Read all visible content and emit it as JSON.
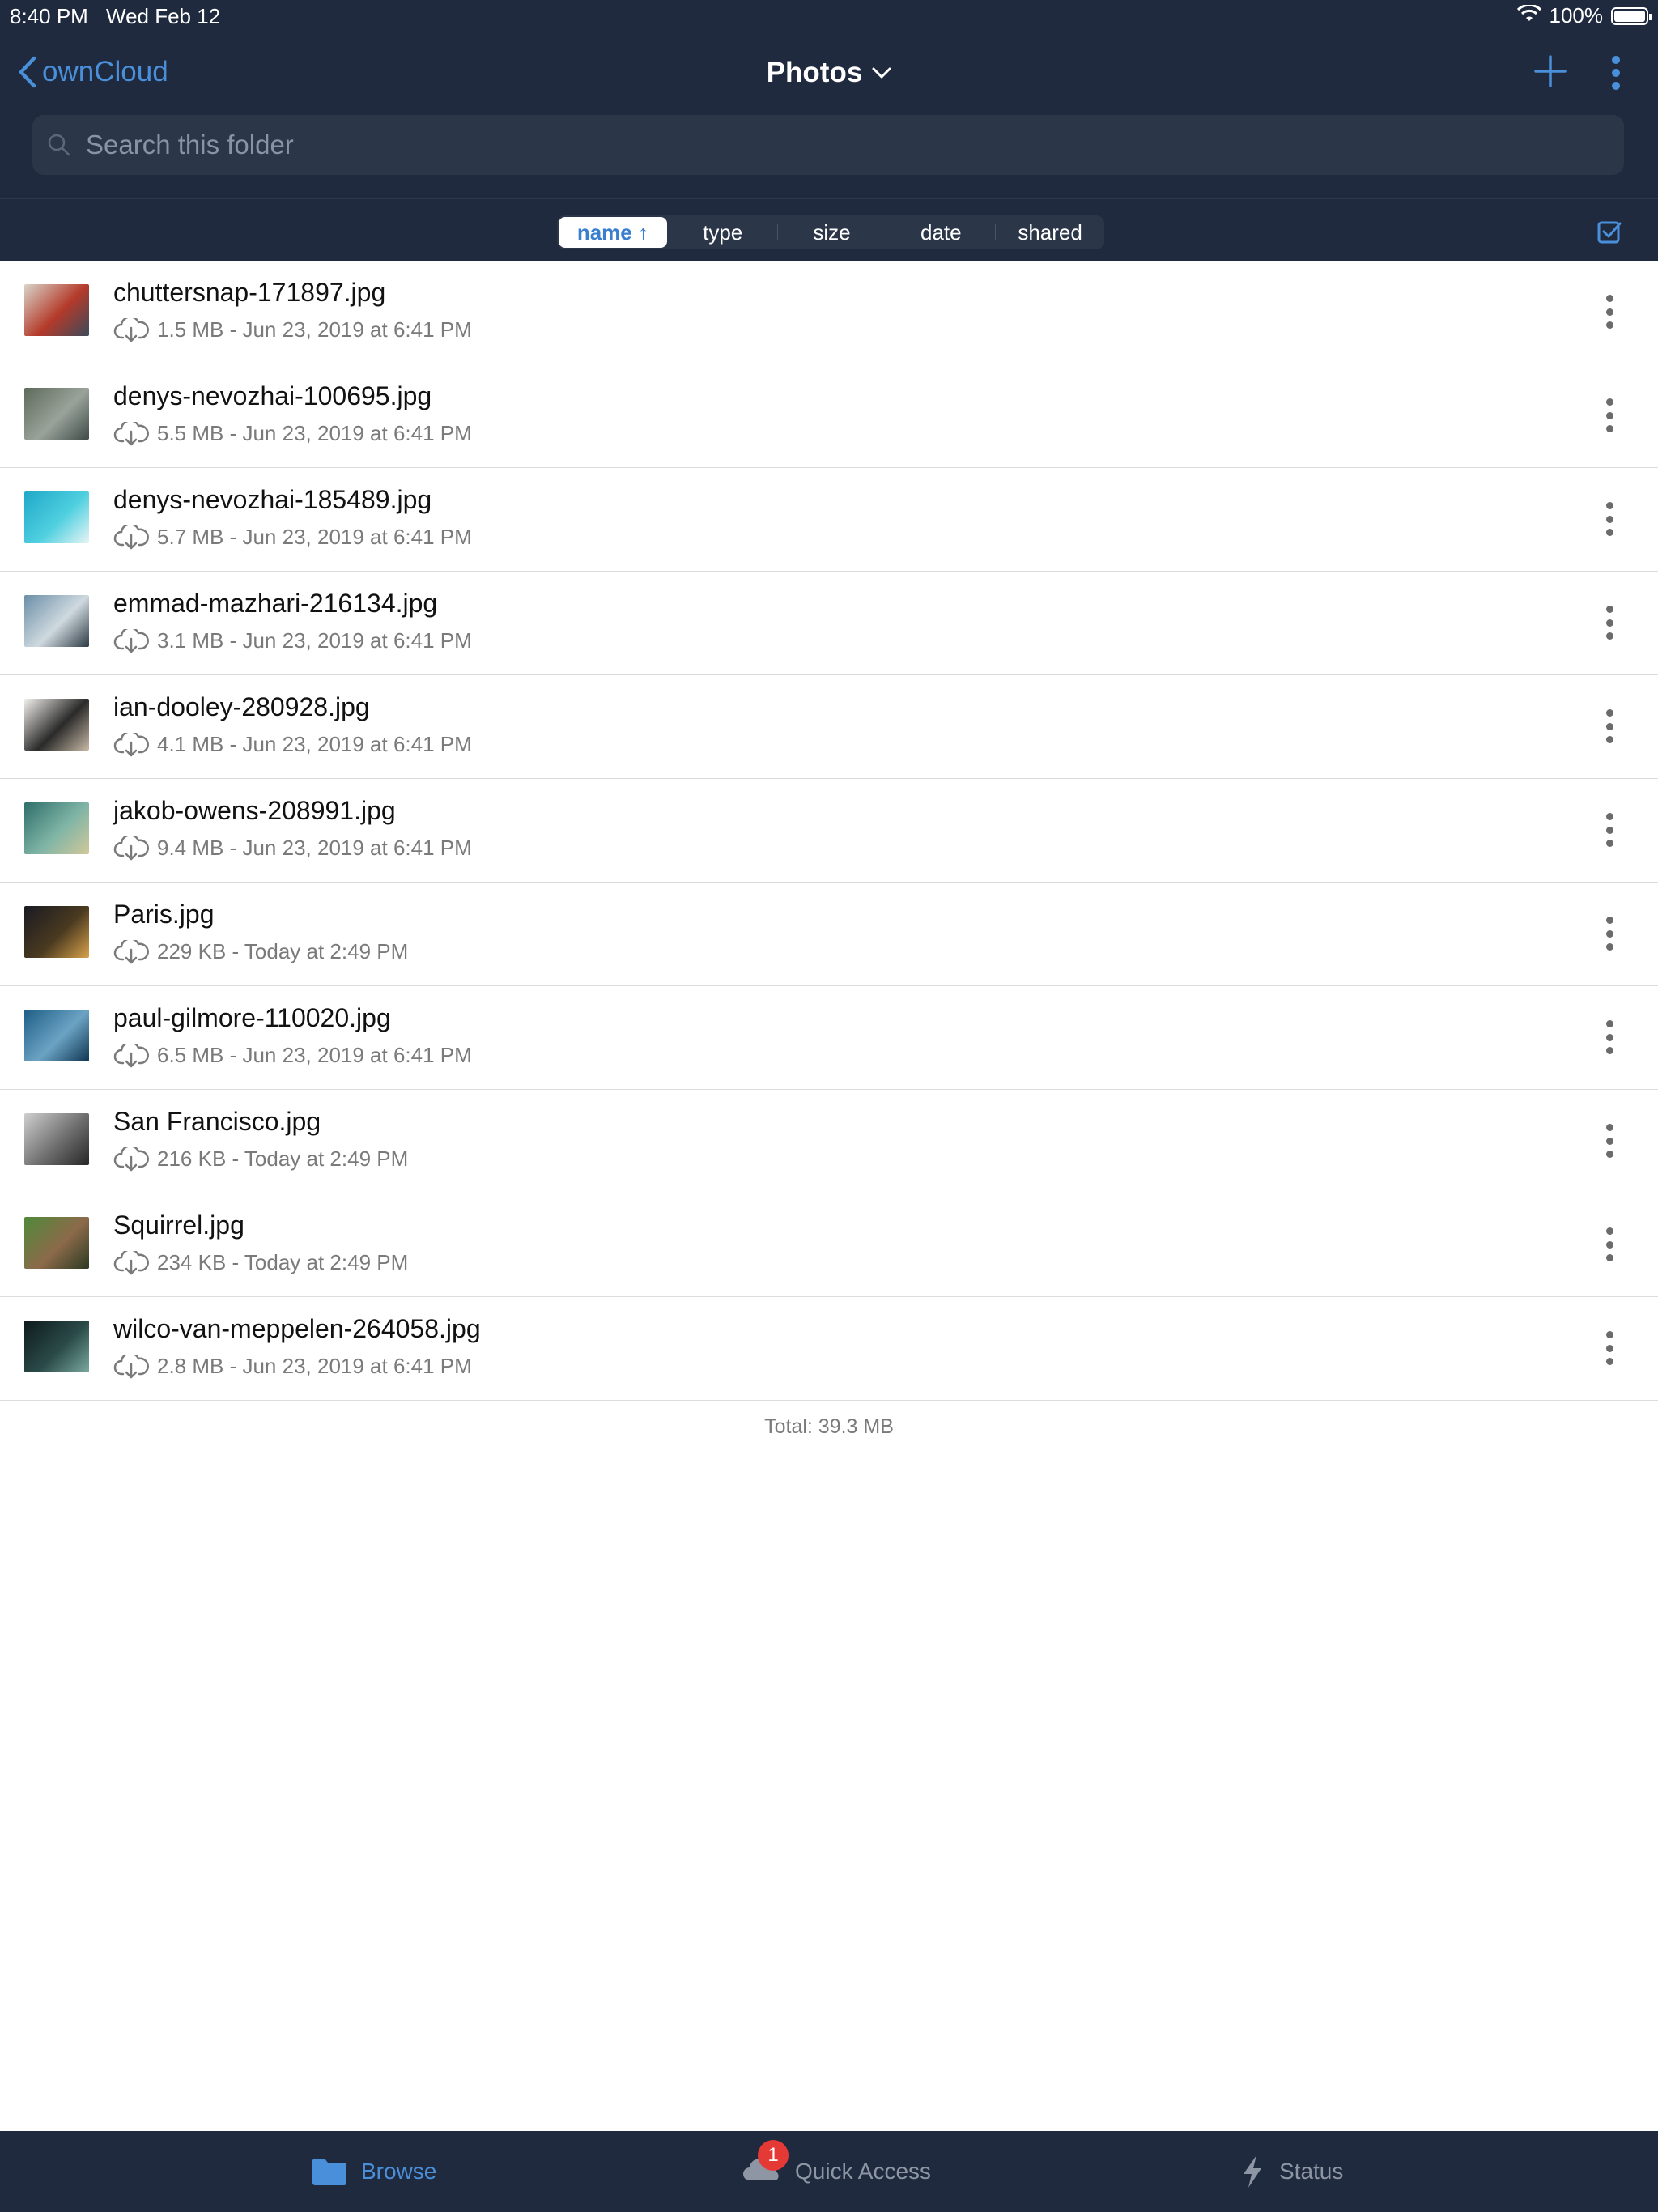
{
  "status_bar": {
    "time": "8:40 PM",
    "date": "Wed Feb 12",
    "battery": "100%"
  },
  "nav": {
    "back_label": "ownCloud",
    "title": "Photos"
  },
  "search": {
    "placeholder": "Search this folder"
  },
  "sort": {
    "options": [
      {
        "label": "name ↑",
        "active": true
      },
      {
        "label": "type",
        "active": false
      },
      {
        "label": "size",
        "active": false
      },
      {
        "label": "date",
        "active": false
      },
      {
        "label": "shared",
        "active": false
      }
    ]
  },
  "files": [
    {
      "name": "chuttersnap-171897.jpg",
      "meta": "1.5 MB - Jun 23, 2019 at 6:41 PM",
      "thumb": [
        "#d9d4c9",
        "#b43a2a",
        "#3b4a5a"
      ]
    },
    {
      "name": "denys-nevozhai-100695.jpg",
      "meta": "5.5 MB - Jun 23, 2019 at 6:41 PM",
      "thumb": [
        "#5d6b5a",
        "#9aa39a",
        "#3e4a48"
      ]
    },
    {
      "name": "denys-nevozhai-185489.jpg",
      "meta": "5.7 MB - Jun 23, 2019 at 6:41 PM",
      "thumb": [
        "#1fa8c8",
        "#4fd0e0",
        "#e9f4f5"
      ]
    },
    {
      "name": "emmad-mazhari-216134.jpg",
      "meta": "3.1 MB - Jun 23, 2019 at 6:41 PM",
      "thumb": [
        "#6b8fa8",
        "#cfd9df",
        "#2d3a44"
      ]
    },
    {
      "name": "ian-dooley-280928.jpg",
      "meta": "4.1 MB - Jun 23, 2019 at 6:41 PM",
      "thumb": [
        "#f2f0ec",
        "#2a2a2a",
        "#c7b9a6"
      ]
    },
    {
      "name": "jakob-owens-208991.jpg",
      "meta": "9.4 MB - Jun 23, 2019 at 6:41 PM",
      "thumb": [
        "#2f6e6a",
        "#7fb5a6",
        "#d2c89a"
      ]
    },
    {
      "name": "Paris.jpg",
      "meta": "229 KB - Today at 2:49 PM",
      "thumb": [
        "#1a1a22",
        "#4a3a20",
        "#d9a24a"
      ]
    },
    {
      "name": "paul-gilmore-110020.jpg",
      "meta": "6.5 MB - Jun 23, 2019 at 6:41 PM",
      "thumb": [
        "#1f5e86",
        "#6ba3c4",
        "#0e3550"
      ]
    },
    {
      "name": "San Francisco.jpg",
      "meta": "216 KB - Today at 2:49 PM",
      "thumb": [
        "#cfcfcf",
        "#6e6e6e",
        "#262626"
      ]
    },
    {
      "name": "Squirrel.jpg",
      "meta": "234 KB - Today at 2:49 PM",
      "thumb": [
        "#4f8a3a",
        "#8c6a4a",
        "#2b3a22"
      ]
    },
    {
      "name": "wilco-van-meppelen-264058.jpg",
      "meta": "2.8 MB - Jun 23, 2019 at 6:41 PM",
      "thumb": [
        "#0e1a1c",
        "#2a4a48",
        "#7aa9a0"
      ]
    }
  ],
  "total": "Total: 39.3 MB",
  "tabs": {
    "browse": "Browse",
    "quick_access": "Quick Access",
    "quick_badge": "1",
    "status": "Status"
  },
  "colors": {
    "nav_bg": "#1f2a3f",
    "accent": "#4a8fd9"
  }
}
